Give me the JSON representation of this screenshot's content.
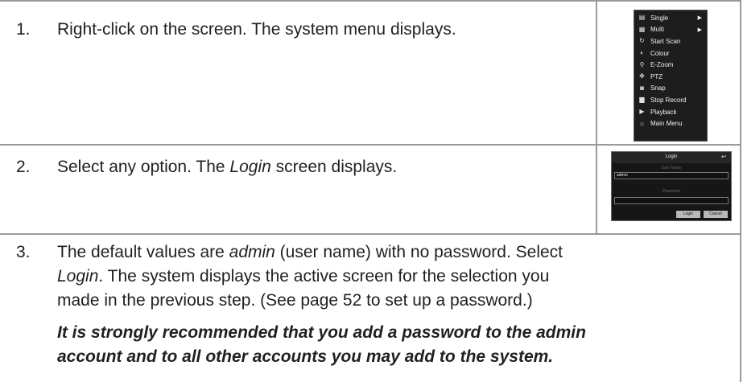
{
  "steps": [
    {
      "number": "1.",
      "text": "Right-click on the screen. The system menu displays."
    },
    {
      "number": "2.",
      "text_before": "Select any option. The ",
      "text_italic": "Login",
      "text_after": " screen displays."
    },
    {
      "number": "3.",
      "line1_before": "The default values are ",
      "line1_italic": "admin",
      "line1_after": " (user name) with no password. Select",
      "line2_italic": "Login",
      "line2_after": ". The system displays the active screen for the selection you",
      "line3": "made in the previous step. (See page 52 to set up a password.)",
      "note_line1": "It is strongly recommended that you add a password to the admin",
      "note_line2": "account and to all other accounts you may add to the system."
    }
  ],
  "system_menu": {
    "items": [
      {
        "icon": "single-view-icon",
        "label": "Single",
        "submenu": true
      },
      {
        "icon": "multi-view-icon",
        "label": "Multi",
        "submenu": true
      },
      {
        "icon": "scan-icon",
        "label": "Start Scan"
      },
      {
        "icon": "colour-icon",
        "label": "Colour"
      },
      {
        "icon": "zoom-icon",
        "label": "E-Zoom"
      },
      {
        "icon": "ptz-icon",
        "label": "PTZ"
      },
      {
        "icon": "snapshot-icon",
        "label": "Snap"
      },
      {
        "icon": "record-icon",
        "label": "Stop Record"
      },
      {
        "icon": "playback-icon",
        "label": "Playback"
      },
      {
        "icon": "home-icon",
        "label": "Main Menu"
      }
    ]
  },
  "login_screen": {
    "title": "Login",
    "user_name_label": "User Name",
    "user_name_value": "admin",
    "password_label": "Password",
    "password_value": "",
    "login_button": "Login",
    "cancel_button": "Cancel"
  }
}
